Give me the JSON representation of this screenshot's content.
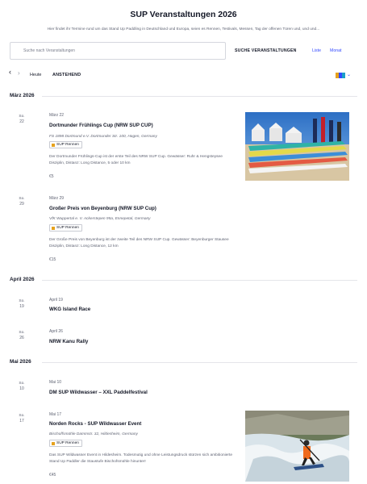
{
  "header": {
    "title": "SUP Veranstaltungen 2026",
    "intro": "Hier findet ihr Termine rund um das Stand Up Paddling in Deutschland und Europa, seien es Rennen, Testivals, Messen, Tag der offenen Türen und, und und..."
  },
  "search": {
    "placeholder": "Suche nach Veranstaltungen",
    "button_label": "SUCHE VERANSTALTUNGEN",
    "view_list": "Liste",
    "view_month": "Monat"
  },
  "nav": {
    "today": "Heute",
    "upcoming": "ANSTEHEND"
  },
  "colors": {
    "accent": "#334aff",
    "tag_dot": "#e6a21d",
    "text": "#141827",
    "muted": "#5f6373"
  },
  "months": [
    {
      "label": "März 2026"
    },
    {
      "label": "April 2026"
    },
    {
      "label": "Mai 2026"
    }
  ],
  "events": [
    {
      "dow": "So.",
      "day": "22",
      "date": "März 22",
      "title": "Dortmunder Frühlings Cup (NRW SUP CUP)",
      "venue": "FS 1898 Dortmund e.V. Dortmunder Str. 100, Hagen, Germany",
      "tag": "SUP Rennen",
      "desc": "Der Dortmunder Frühlings-Cup ist der erste Teil des NRW SUP Cup. Gewässer: Ruhr & Hengsteysee Disziplin, Distanz: Long Distance, 5 oder 10 km",
      "price": "€5"
    },
    {
      "dow": "So.",
      "day": "29",
      "date": "März 29",
      "title": "Großer Preis von Beyenburg (NRW SUP Cup)",
      "venue": "VfK Wuppertal e. V. Ackerstepen 95a, Ennepetal, Germany",
      "tag": "SUP Rennen",
      "desc": "Der Große Preis von Beyenburg ist der zweite Teil des NRW SUP Cup. Gewässer: Beyenburger Stausee Disziplin, Distanz: Long Distance, 12 km",
      "price": "€15"
    },
    {
      "dow": "So.",
      "day": "19",
      "date": "April 19",
      "title": "WKG Island Race"
    },
    {
      "dow": "So.",
      "day": "26",
      "date": "April 26",
      "title": "NRW Kanu Rally"
    },
    {
      "dow": "So.",
      "day": "10",
      "date": "Mai 10",
      "title": "DM SUP Wildwasser – XXL Paddelfestival"
    },
    {
      "dow": "So.",
      "day": "17",
      "date": "Mai 17",
      "title": "Norden Rocks - SUP Wildwasser Event",
      "venue": "Bischoffsmühle Dammstr. 32, Hildesheim, Germany",
      "tag": "SUP Rennen",
      "desc": "Das SUP Wildwasser Event in Hildesheim. Todesmutig und ohne Leistungsdruck stürzen sich ambitionierte Stand Up Paddler die Staustufe Bischofsmühle hinunter!",
      "price": "€45"
    }
  ]
}
